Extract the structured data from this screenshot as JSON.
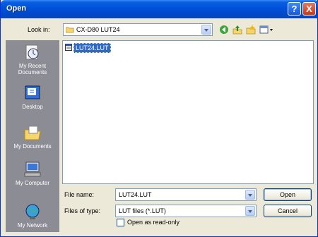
{
  "window": {
    "title": "Open",
    "help_glyph": "?",
    "close_glyph": "X"
  },
  "toolbar": {
    "look_in_label": "Look in:",
    "look_in_value": "CX-D80 LUT24",
    "icons": [
      "back-icon",
      "up-folder-icon",
      "new-folder-icon",
      "views-menu-icon"
    ]
  },
  "places": [
    {
      "label": "My Recent Documents",
      "icon": "recent-documents-icon"
    },
    {
      "label": "Desktop",
      "icon": "desktop-icon"
    },
    {
      "label": "My Documents",
      "icon": "my-documents-icon"
    },
    {
      "label": "My Computer",
      "icon": "my-computer-icon"
    },
    {
      "label": "My Network",
      "icon": "my-network-icon"
    }
  ],
  "files": [
    {
      "name": "LUT24.LUT",
      "selected": true
    }
  ],
  "form": {
    "file_name_label": "File name:",
    "file_name_value": "LUT24.LUT",
    "file_type_label": "Files of type:",
    "file_type_value": "LUT files (*.LUT)",
    "readonly_label": "Open as read-only",
    "readonly_checked": false
  },
  "buttons": {
    "open": "Open",
    "cancel": "Cancel"
  },
  "colors": {
    "title_bar": "#0054e3",
    "places_bar": "#8c8d94",
    "selection": "#316ac5",
    "dialog_bg": "#ece9d8"
  }
}
